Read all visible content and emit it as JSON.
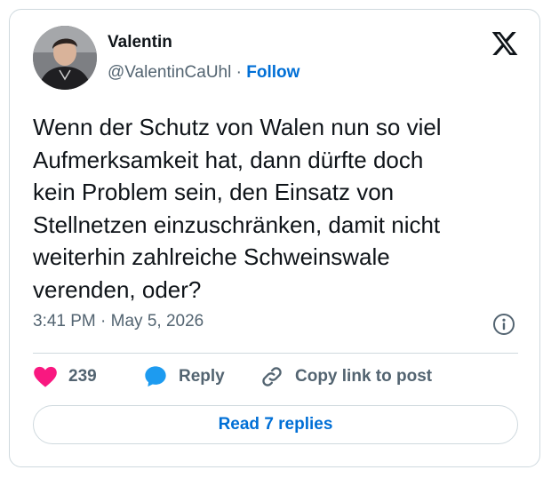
{
  "author": {
    "name": "Valentin",
    "handle": "@ValentinCaUhl",
    "separator": "·",
    "follow_label": "Follow"
  },
  "tweet": {
    "lines": [
      "Wenn der Schutz von Walen nun so viel",
      "Aufmerksamkeit hat, dann dürfte doch",
      "kein Problem sein, den Einsatz von",
      "Stellnetzen einzuschränken, damit nicht",
      "weiterhin zahlreiche Schweinswale",
      "verenden, oder?"
    ],
    "time": "3:41 PM",
    "separator": "·",
    "date": "May 5, 2026"
  },
  "actions": {
    "like_count": "239",
    "reply_label": "Reply",
    "copy_label": "Copy link to post"
  },
  "read_replies_label": "Read 7 replies",
  "icons": {
    "brand": "x-logo-icon",
    "info": "info-icon",
    "like": "heart-icon",
    "reply": "speech-bubble-icon",
    "copy": "link-icon"
  },
  "colors": {
    "like": "#f91880",
    "reply": "#1d9bf0",
    "follow": "#006fd6",
    "muted": "#536471",
    "text": "#0f1419",
    "border": "#cfd9de"
  }
}
